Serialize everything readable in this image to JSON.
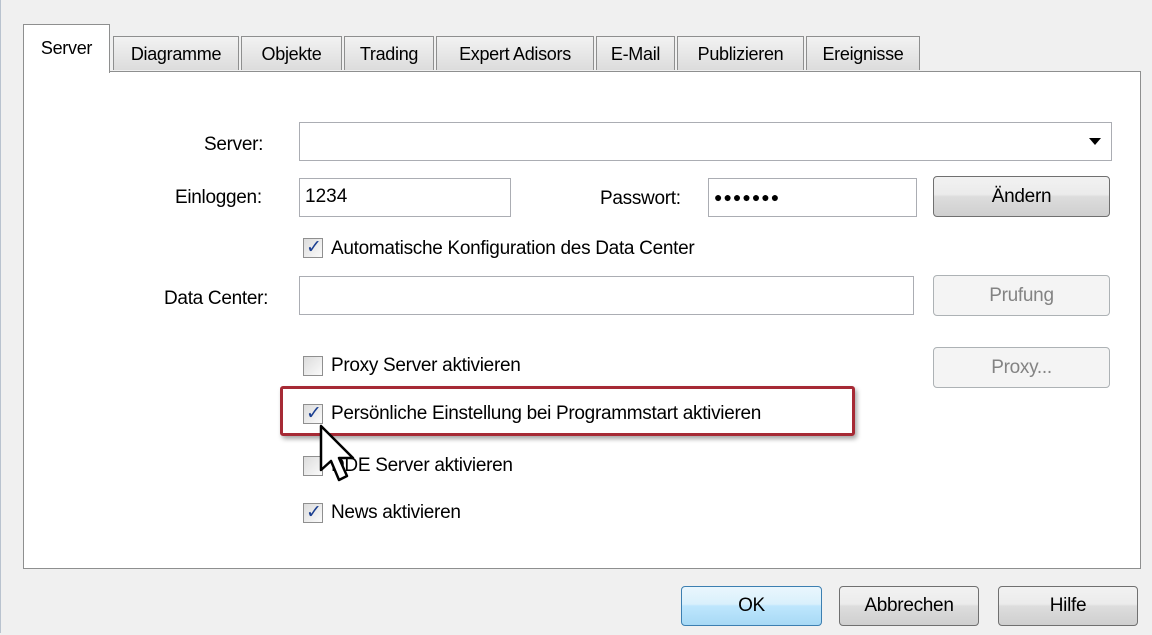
{
  "tabs": [
    {
      "label": "Server",
      "active": true
    },
    {
      "label": "Diagramme"
    },
    {
      "label": "Objekte"
    },
    {
      "label": "Trading"
    },
    {
      "label": "Expert Adisors"
    },
    {
      "label": "E-Mail"
    },
    {
      "label": "Publizieren"
    },
    {
      "label": "Ereignisse"
    }
  ],
  "server": {
    "server_label": "Server:",
    "server_value": "",
    "login_label": "Einloggen:",
    "login_value": "1234",
    "password_label": "Passwort:",
    "password_value": "●●●●●●●",
    "change_button": "Ändern",
    "auto_config_label": "Automatische Konfiguration des Data Center",
    "auto_config_checked": true,
    "data_center_label": "Data Center:",
    "data_center_value": "",
    "check_button": "Prufung",
    "proxy_label": "Proxy Server aktivieren",
    "proxy_checked": false,
    "proxy_button": "Proxy...",
    "personal_label": "Persönliche Einstellung bei Programmstart aktivieren",
    "personal_checked": true,
    "dde_label": "DDE Server aktivieren",
    "dde_checked": false,
    "news_label": "News aktivieren",
    "news_checked": true
  },
  "footer": {
    "ok": "OK",
    "cancel": "Abbrechen",
    "help": "Hilfe"
  },
  "colors": {
    "highlight": "#a62a35",
    "check": "#1b3f91"
  },
  "icons": {
    "combo_arrow": "chevron-down-icon",
    "cursor": "mouse-pointer-icon"
  }
}
